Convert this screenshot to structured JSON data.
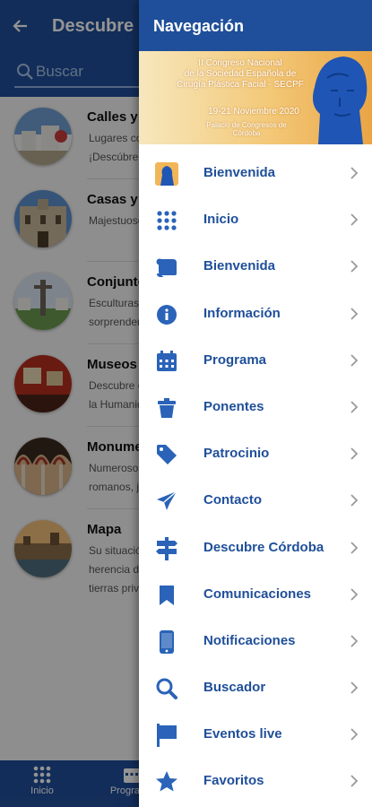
{
  "background": {
    "title": "Descubre Córdoba",
    "search": {
      "placeholder": "Buscar"
    },
    "items": [
      {
        "title": "Calles y patios",
        "desc": "Lugares con encanto ¡Descúbrelos!"
      },
      {
        "title": "Casas y palacios",
        "desc": "Majestuosos edificios"
      },
      {
        "title": "Conjuntos monumentales",
        "desc": "Esculturas que te sorprenderán"
      },
      {
        "title": "Museos",
        "desc": "Descubre el Patrimonio de la Humanidad"
      },
      {
        "title": "Monumentos",
        "desc": "Numerosos restos romanos, judíos"
      },
      {
        "title": "Mapa",
        "desc": "Su situación geográfica y la herencia de sus ricas tierras privilegiadas"
      }
    ],
    "tabbar": [
      {
        "label": "Inicio",
        "icon": "grid-icon"
      },
      {
        "label": "Programa",
        "icon": "calendar-icon"
      }
    ]
  },
  "drawer": {
    "title": "Navegación",
    "banner": {
      "line1": "II Congreso Nacional",
      "line2": "de la Sociedad Española de",
      "line3": "Cirugía Plástica Facial - SECPF",
      "date": "19-21 Noviembre 2020",
      "venue": "Palacio de Congresos de Córdoba"
    },
    "items": [
      {
        "label": "Bienvenida",
        "icon": "welcome-photo-icon"
      },
      {
        "label": "Inicio",
        "icon": "grid-icon"
      },
      {
        "label": "Bienvenida",
        "icon": "scroll-icon"
      },
      {
        "label": "Información",
        "icon": "info-icon"
      },
      {
        "label": "Programa",
        "icon": "calendar-icon"
      },
      {
        "label": "Ponentes",
        "icon": "cup-icon"
      },
      {
        "label": "Patrocinio",
        "icon": "tag-icon"
      },
      {
        "label": "Contacto",
        "icon": "paper-plane-icon"
      },
      {
        "label": "Descubre Córdoba",
        "icon": "signpost-icon"
      },
      {
        "label": "Comunicaciones",
        "icon": "bookmark-icon"
      },
      {
        "label": "Notificaciones",
        "icon": "mobile-icon"
      },
      {
        "label": "Buscador",
        "icon": "search-icon"
      },
      {
        "label": "Eventos live",
        "icon": "flag-icon"
      },
      {
        "label": "Favoritos",
        "icon": "star-icon"
      }
    ]
  },
  "colors": {
    "primary": "#1f4f9a",
    "icon": "#2a63b8"
  }
}
